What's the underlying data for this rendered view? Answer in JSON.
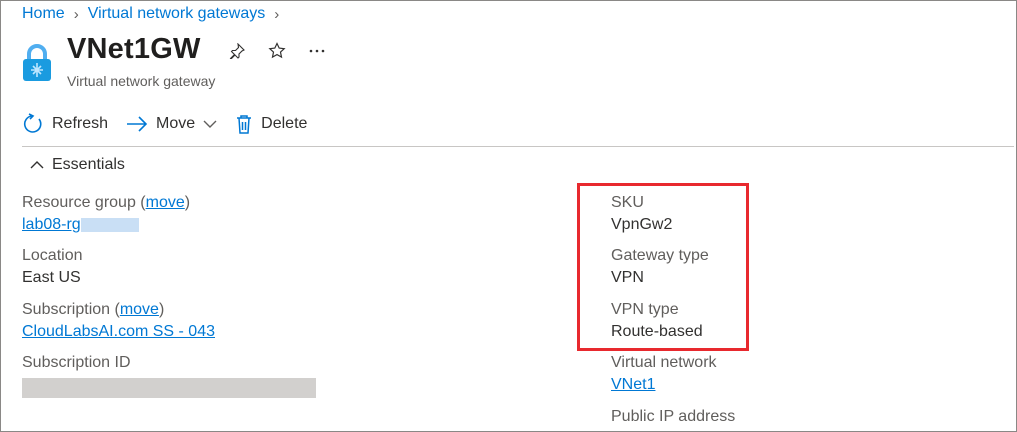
{
  "breadcrumb": {
    "items": [
      "Home",
      "Virtual network gateways"
    ]
  },
  "resource": {
    "title": "VNet1GW",
    "subtitle": "Virtual network gateway"
  },
  "toolbar": {
    "refresh_label": "Refresh",
    "move_label": "Move",
    "delete_label": "Delete"
  },
  "essentials": {
    "toggle_label": "Essentials",
    "left": {
      "resource_group_label": "Resource group",
      "move_link": "move",
      "resource_group_value": "lab08-rg",
      "location_label": "Location",
      "location_value": "East US",
      "subscription_label": "Subscription",
      "subscription_value": "CloudLabsAI.com SS - 043",
      "subscription_id_label": "Subscription ID"
    },
    "right": {
      "sku_label": "SKU",
      "sku_value": "VpnGw2",
      "gateway_type_label": "Gateway type",
      "gateway_type_value": "VPN",
      "vpn_type_label": "VPN type",
      "vpn_type_value": "Route-based",
      "virtual_network_label": "Virtual network",
      "virtual_network_value": "VNet1",
      "public_ip_label": "Public IP address"
    }
  },
  "colors": {
    "accent": "#0078d4",
    "highlight": "#e8292e"
  }
}
